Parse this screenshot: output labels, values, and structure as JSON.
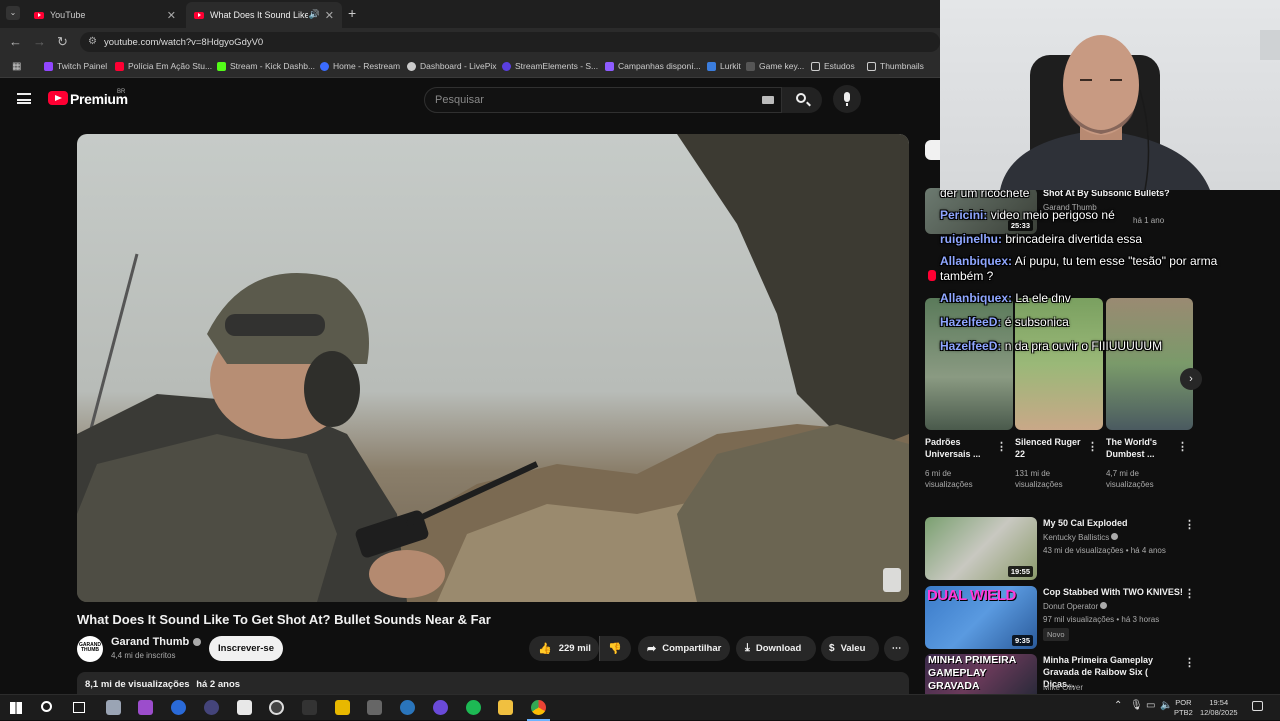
{
  "browser": {
    "tabs": [
      {
        "title": "YouTube",
        "active": false
      },
      {
        "title": "What Does It Sound Like To",
        "active": true
      }
    ],
    "new_tab_label": "+",
    "url": "youtube.com/watch?v=8HdgyoGdyV0",
    "bookmarks": [
      {
        "label": "Twitch Painel",
        "color": "#9146ff"
      },
      {
        "label": "Polícia Em Ação Stu...",
        "color": "#ff0033"
      },
      {
        "label": "Stream - Kick Dashb...",
        "color": "#53fc18"
      },
      {
        "label": "Home - Restream",
        "color": "#3b6cff"
      },
      {
        "label": "Dashboard - LivePix",
        "color": "#cccccc"
      },
      {
        "label": "StreamElements - S...",
        "color": "#5a3fe0"
      },
      {
        "label": "Campanhas disponí...",
        "color": "#8e5cff"
      },
      {
        "label": "Lurkit",
        "color": "#3b7ddd"
      },
      {
        "label": "Game key...",
        "color": "#555555"
      },
      {
        "label": "Estudos",
        "color": "folder"
      },
      {
        "label": "Thumbnails",
        "color": "folder"
      }
    ]
  },
  "youtube": {
    "logo_text": "Premium",
    "country_code": "BR",
    "search_placeholder": "Pesquisar",
    "video": {
      "title": "What Does It Sound Like To Get Shot At? Bullet Sounds Near & Far",
      "channel": "Garand Thumb",
      "channel_avatar_text": "GARAND THUMB",
      "subscribers": "4,4 mi de inscritos",
      "subscribe_label": "Inscrever-se",
      "likes": "229 mil",
      "share_label": "Compartilhar",
      "download_label": "Download",
      "thanks_label": "Valeu",
      "views": "8,1 mi de visualizações",
      "age": "há 2 anos"
    },
    "sidebar": {
      "top_partial": {
        "title": "Shot At By Subsonic Bullets?",
        "channel": "Garand Thumb",
        "meta": "há 1 ano",
        "duration": "25:33"
      },
      "shorts": [
        {
          "title": "Padrões Universais ...",
          "views": "6 mi de visualizações"
        },
        {
          "title": "Silenced Ruger 22",
          "views": "131 mi de visualizações"
        },
        {
          "title": "The World's Dumbest ...",
          "views": "4,7 mi de visualizações"
        }
      ],
      "videos": [
        {
          "title": "My 50 Cal Exploded",
          "channel": "Kentucky Ballistics",
          "meta": "43 mi de visualizações • há 4 anos",
          "duration": "19:55"
        },
        {
          "title": "Cop Stabbed With TWO KNIVES!",
          "channel": "Donut Operator",
          "meta": "97 mil visualizações • há 3 horas",
          "duration": "9:35",
          "badge": "Novo",
          "thumb_text": "DUAL WIELD"
        },
        {
          "title": "Minha Primeira Gameplay Gravada de Raibow Six ( Dicas...",
          "channel": "Mike Oliver",
          "thumb_text": "MINHA PRIMEIRA GAMEPLAY GRAVADA"
        }
      ]
    }
  },
  "chat": [
    {
      "user": "",
      "text": "der um ricochete"
    },
    {
      "user": "Pericini:",
      "text": "video meio perigoso né"
    },
    {
      "user": "ruiginelhu:",
      "text": "brincadeira divertida essa"
    },
    {
      "user": "Allanbiquex:",
      "text": "Aí pupu, tu tem esse \"tesão\" por arma"
    },
    {
      "user": "",
      "text": "também ?"
    },
    {
      "user": "Allanbiquex:",
      "text": "La ele dnv"
    },
    {
      "user": "HazelfeeD:",
      "text": "é subsonica"
    },
    {
      "user": "HazelfeeD:",
      "text": "n da pra ouvir o FIIIUUUUUM"
    }
  ],
  "taskbar": {
    "lang": "POR",
    "layout": "PTB2",
    "time": "19:54",
    "date": "12/08/2025"
  }
}
